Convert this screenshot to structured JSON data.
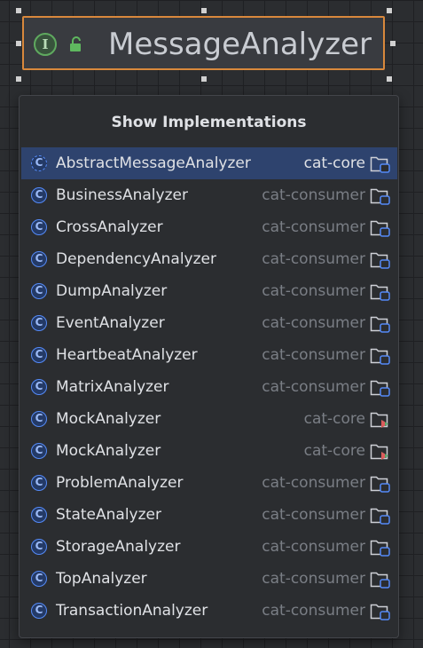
{
  "node": {
    "title": "MessageAnalyzer",
    "icon_glyph": "I",
    "icon_name": "interface-icon",
    "lock_name": "unlocked-icon",
    "border_color": "#d8883c"
  },
  "popup": {
    "title": "Show Implementations",
    "items": [
      {
        "name": "AbstractMessageAnalyzer",
        "module": "cat-core",
        "selected": true,
        "abstract": true,
        "module_icon": "folder-module-icon"
      },
      {
        "name": "BusinessAnalyzer",
        "module": "cat-consumer",
        "module_icon": "folder-module-icon"
      },
      {
        "name": "CrossAnalyzer",
        "module": "cat-consumer",
        "module_icon": "folder-module-icon"
      },
      {
        "name": "DependencyAnalyzer",
        "module": "cat-consumer",
        "module_icon": "folder-module-icon"
      },
      {
        "name": "DumpAnalyzer",
        "module": "cat-consumer",
        "module_icon": "folder-module-icon"
      },
      {
        "name": "EventAnalyzer",
        "module": "cat-consumer",
        "module_icon": "folder-module-icon"
      },
      {
        "name": "HeartbeatAnalyzer",
        "module": "cat-consumer",
        "module_icon": "folder-module-icon"
      },
      {
        "name": "MatrixAnalyzer",
        "module": "cat-consumer",
        "module_icon": "folder-module-icon"
      },
      {
        "name": "MockAnalyzer",
        "module": "cat-core",
        "module_icon": "test-folder-icon"
      },
      {
        "name": "MockAnalyzer",
        "module": "cat-core",
        "module_icon": "test-folder-icon"
      },
      {
        "name": "ProblemAnalyzer",
        "module": "cat-consumer",
        "module_icon": "folder-module-icon"
      },
      {
        "name": "StateAnalyzer",
        "module": "cat-consumer",
        "module_icon": "folder-module-icon"
      },
      {
        "name": "StorageAnalyzer",
        "module": "cat-consumer",
        "module_icon": "folder-module-icon"
      },
      {
        "name": "TopAnalyzer",
        "module": "cat-consumer",
        "module_icon": "folder-module-icon"
      },
      {
        "name": "TransactionAnalyzer",
        "module": "cat-consumer",
        "module_icon": "folder-module-icon"
      }
    ],
    "class_icon_glyph": "C",
    "colors": {
      "selection": "#2e436e",
      "class_icon": "#548af7",
      "module_text": "#7a7e85"
    }
  }
}
